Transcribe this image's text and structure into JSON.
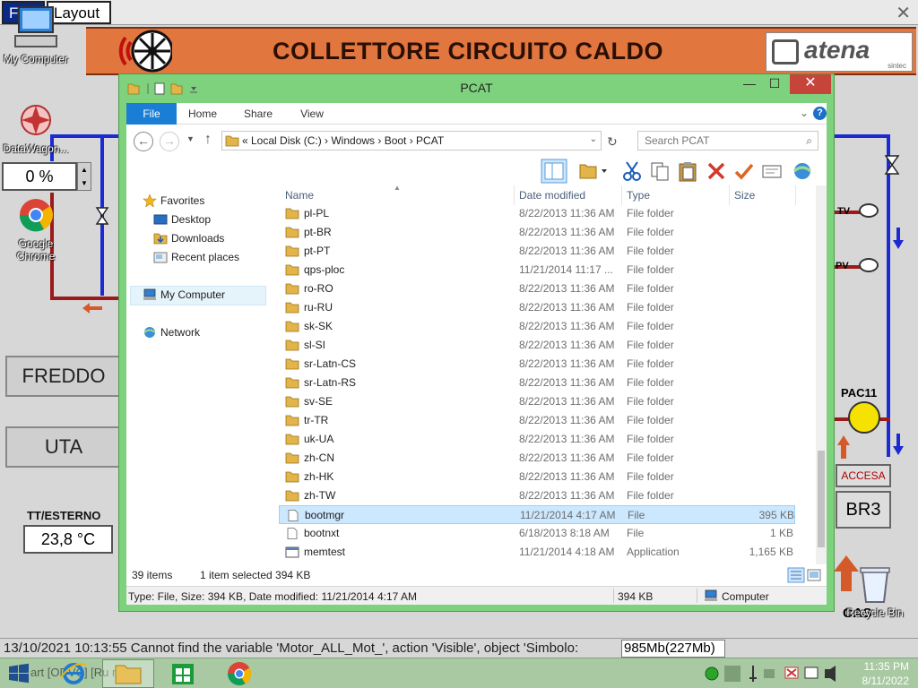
{
  "scada": {
    "menu": {
      "file": "File",
      "layout": "Layout"
    },
    "close_glyph": "✕",
    "banner_title": "COLLETTORE CIRCUITO CALDO",
    "logo_text": "atena",
    "logo_sub": "sintec",
    "buttons": {
      "freddo": "FREDDO",
      "uta": "UTA"
    },
    "tt_label": "TT/ESTERNO",
    "tt_value": "23,8 °C",
    "percent_value": "0 %",
    "pac_label": "PAC11",
    "accesa": "ACCESA",
    "br3": "BR3",
    "gas": "GAS",
    "valve_tv": "TV",
    "valve_pv": "PV",
    "message": "13/10/2021 10:13:55 Cannot find the variable 'Motor_ALL_Mot_', action 'Visible', object 'Simbolo:",
    "memory": "985Mb(227Mb)"
  },
  "desktop": {
    "my_computer": "My Computer",
    "datawagon": "DataWagon...",
    "chrome": [
      "Google",
      "Chrome"
    ],
    "recycle_bin": "Recycle Bin"
  },
  "taskbar": {
    "clock_time": "11:35 PM",
    "clock_date": "8/11/2022",
    "ghost_text": "art   [ODVC] [Ru  ne]"
  },
  "window": {
    "title": "PCAT",
    "controls": {
      "min": "—",
      "max": "☐",
      "close": "✕"
    },
    "tabs": {
      "file": "File",
      "home": "Home",
      "share": "Share",
      "view": "View"
    },
    "breadcrumb": "«  Local Disk (C:)  ›  Windows  ›  Boot  ›  PCAT",
    "search_placeholder": "Search PCAT",
    "nav": {
      "favorites": "Favorites",
      "desktop": "Desktop",
      "downloads": "Downloads",
      "recent": "Recent places",
      "my_computer": "My Computer",
      "network": "Network"
    },
    "columns": {
      "name": "Name",
      "date": "Date modified",
      "type": "Type",
      "size": "Size"
    },
    "files": [
      {
        "name": "pl-PL",
        "date": "8/22/2013 11:36 AM",
        "type": "File folder",
        "size": "",
        "icon": "folder"
      },
      {
        "name": "pt-BR",
        "date": "8/22/2013 11:36 AM",
        "type": "File folder",
        "size": "",
        "icon": "folder"
      },
      {
        "name": "pt-PT",
        "date": "8/22/2013 11:36 AM",
        "type": "File folder",
        "size": "",
        "icon": "folder"
      },
      {
        "name": "qps-ploc",
        "date": "11/21/2014 11:17 ...",
        "type": "File folder",
        "size": "",
        "icon": "folder"
      },
      {
        "name": "ro-RO",
        "date": "8/22/2013 11:36 AM",
        "type": "File folder",
        "size": "",
        "icon": "folder"
      },
      {
        "name": "ru-RU",
        "date": "8/22/2013 11:36 AM",
        "type": "File folder",
        "size": "",
        "icon": "folder"
      },
      {
        "name": "sk-SK",
        "date": "8/22/2013 11:36 AM",
        "type": "File folder",
        "size": "",
        "icon": "folder"
      },
      {
        "name": "sl-SI",
        "date": "8/22/2013 11:36 AM",
        "type": "File folder",
        "size": "",
        "icon": "folder"
      },
      {
        "name": "sr-Latn-CS",
        "date": "8/22/2013 11:36 AM",
        "type": "File folder",
        "size": "",
        "icon": "folder"
      },
      {
        "name": "sr-Latn-RS",
        "date": "8/22/2013 11:36 AM",
        "type": "File folder",
        "size": "",
        "icon": "folder"
      },
      {
        "name": "sv-SE",
        "date": "8/22/2013 11:36 AM",
        "type": "File folder",
        "size": "",
        "icon": "folder"
      },
      {
        "name": "tr-TR",
        "date": "8/22/2013 11:36 AM",
        "type": "File folder",
        "size": "",
        "icon": "folder"
      },
      {
        "name": "uk-UA",
        "date": "8/22/2013 11:36 AM",
        "type": "File folder",
        "size": "",
        "icon": "folder"
      },
      {
        "name": "zh-CN",
        "date": "8/22/2013 11:36 AM",
        "type": "File folder",
        "size": "",
        "icon": "folder"
      },
      {
        "name": "zh-HK",
        "date": "8/22/2013 11:36 AM",
        "type": "File folder",
        "size": "",
        "icon": "folder"
      },
      {
        "name": "zh-TW",
        "date": "8/22/2013 11:36 AM",
        "type": "File folder",
        "size": "",
        "icon": "folder"
      },
      {
        "name": "bootmgr",
        "date": "11/21/2014 4:17 AM",
        "type": "File",
        "size": "395 KB",
        "icon": "file",
        "selected": true
      },
      {
        "name": "bootnxt",
        "date": "6/18/2013 8:18 AM",
        "type": "File",
        "size": "1 KB",
        "icon": "file"
      },
      {
        "name": "memtest",
        "date": "11/21/2014 4:18 AM",
        "type": "Application",
        "size": "1,165 KB",
        "icon": "app"
      }
    ],
    "status": {
      "count": "39 items",
      "selected": "1 item selected  394 KB"
    },
    "details": {
      "info": "Type: File, Size: 394 KB, Date modified: 11/21/2014 4:17 AM",
      "size": "394 KB",
      "location": "Computer"
    },
    "colors": {
      "frame": "#7ed27e",
      "accent": "#1a7fd4",
      "selection": "#cce8ff",
      "close": "#c7443b"
    }
  }
}
